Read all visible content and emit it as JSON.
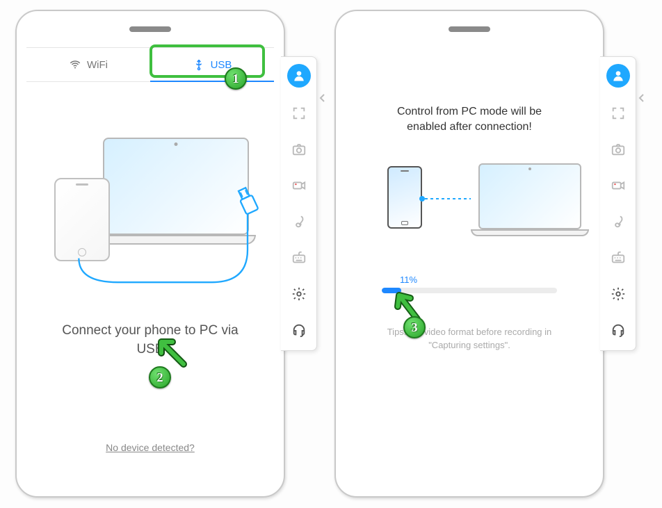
{
  "left": {
    "tabs": {
      "wifi": "WiFi",
      "usb": "USB",
      "active": "usb"
    },
    "main_text": "Connect your phone to PC via USB",
    "link_text": "No device detected?"
  },
  "right": {
    "heading": "Control from PC mode will be enabled after connection!",
    "progress_percent": 11,
    "progress_label": "11%",
    "tips_prefix": "Tips:",
    "tips_body": " the video format before recording in \"Capturing settings\"."
  },
  "sidebar": {
    "icons": [
      "user",
      "fullscreen",
      "camera",
      "record",
      "brush",
      "keyboard",
      "settings",
      "headset"
    ]
  },
  "annotations": {
    "badge1": "1",
    "badge2": "2",
    "badge3": "3"
  }
}
